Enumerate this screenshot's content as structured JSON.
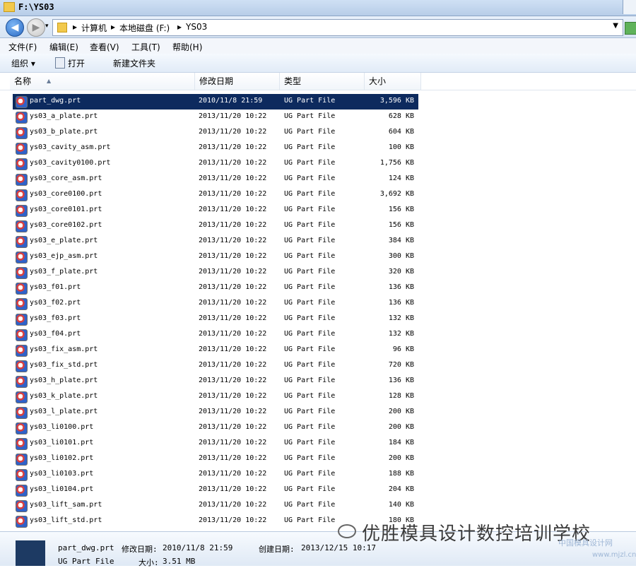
{
  "window": {
    "title": "F:\\YS03"
  },
  "address": {
    "crumbs": [
      "计算机",
      "本地磁盘 (F:)",
      "YS03"
    ]
  },
  "menu": [
    "文件(F)",
    "编辑(E)",
    "查看(V)",
    "工具(T)",
    "帮助(H)"
  ],
  "toolbar": {
    "organize": "组织",
    "open": "打开",
    "new_folder": "新建文件夹"
  },
  "columns": {
    "name": "名称",
    "date": "修改日期",
    "type": "类型",
    "size": "大小"
  },
  "files": [
    {
      "name": "part_dwg.prt",
      "date": "2010/11/8 21:59",
      "type": "UG Part File",
      "size": "3,596 KB",
      "selected": true
    },
    {
      "name": "ys03_a_plate.prt",
      "date": "2013/11/20 10:22",
      "type": "UG Part File",
      "size": "628 KB"
    },
    {
      "name": "ys03_b_plate.prt",
      "date": "2013/11/20 10:22",
      "type": "UG Part File",
      "size": "604 KB"
    },
    {
      "name": "ys03_cavity_asm.prt",
      "date": "2013/11/20 10:22",
      "type": "UG Part File",
      "size": "100 KB"
    },
    {
      "name": "ys03_cavity0100.prt",
      "date": "2013/11/20 10:22",
      "type": "UG Part File",
      "size": "1,756 KB"
    },
    {
      "name": "ys03_core_asm.prt",
      "date": "2013/11/20 10:22",
      "type": "UG Part File",
      "size": "124 KB"
    },
    {
      "name": "ys03_core0100.prt",
      "date": "2013/11/20 10:22",
      "type": "UG Part File",
      "size": "3,692 KB"
    },
    {
      "name": "ys03_core0101.prt",
      "date": "2013/11/20 10:22",
      "type": "UG Part File",
      "size": "156 KB"
    },
    {
      "name": "ys03_core0102.prt",
      "date": "2013/11/20 10:22",
      "type": "UG Part File",
      "size": "156 KB"
    },
    {
      "name": "ys03_e_plate.prt",
      "date": "2013/11/20 10:22",
      "type": "UG Part File",
      "size": "384 KB"
    },
    {
      "name": "ys03_ejp_asm.prt",
      "date": "2013/11/20 10:22",
      "type": "UG Part File",
      "size": "300 KB"
    },
    {
      "name": "ys03_f_plate.prt",
      "date": "2013/11/20 10:22",
      "type": "UG Part File",
      "size": "320 KB"
    },
    {
      "name": "ys03_f01.prt",
      "date": "2013/11/20 10:22",
      "type": "UG Part File",
      "size": "136 KB"
    },
    {
      "name": "ys03_f02.prt",
      "date": "2013/11/20 10:22",
      "type": "UG Part File",
      "size": "136 KB"
    },
    {
      "name": "ys03_f03.prt",
      "date": "2013/11/20 10:22",
      "type": "UG Part File",
      "size": "132 KB"
    },
    {
      "name": "ys03_f04.prt",
      "date": "2013/11/20 10:22",
      "type": "UG Part File",
      "size": "132 KB"
    },
    {
      "name": "ys03_fix_asm.prt",
      "date": "2013/11/20 10:22",
      "type": "UG Part File",
      "size": "96 KB"
    },
    {
      "name": "ys03_fix_std.prt",
      "date": "2013/11/20 10:22",
      "type": "UG Part File",
      "size": "720 KB"
    },
    {
      "name": "ys03_h_plate.prt",
      "date": "2013/11/20 10:22",
      "type": "UG Part File",
      "size": "136 KB"
    },
    {
      "name": "ys03_k_plate.prt",
      "date": "2013/11/20 10:22",
      "type": "UG Part File",
      "size": "128 KB"
    },
    {
      "name": "ys03_l_plate.prt",
      "date": "2013/11/20 10:22",
      "type": "UG Part File",
      "size": "200 KB"
    },
    {
      "name": "ys03_li0100.prt",
      "date": "2013/11/20 10:22",
      "type": "UG Part File",
      "size": "200 KB"
    },
    {
      "name": "ys03_li0101.prt",
      "date": "2013/11/20 10:22",
      "type": "UG Part File",
      "size": "184 KB"
    },
    {
      "name": "ys03_li0102.prt",
      "date": "2013/11/20 10:22",
      "type": "UG Part File",
      "size": "200 KB"
    },
    {
      "name": "ys03_li0103.prt",
      "date": "2013/11/20 10:22",
      "type": "UG Part File",
      "size": "188 KB"
    },
    {
      "name": "ys03_li0104.prt",
      "date": "2013/11/20 10:22",
      "type": "UG Part File",
      "size": "204 KB"
    },
    {
      "name": "ys03_lift_sam.prt",
      "date": "2013/11/20 10:22",
      "type": "UG Part File",
      "size": "140 KB"
    },
    {
      "name": "ys03_lift_std.prt",
      "date": "2013/11/20 10:22",
      "type": "UG Part File",
      "size": "180 KB"
    }
  ],
  "details": {
    "filename": "part_dwg.prt",
    "modified_label": "修改日期:",
    "modified": "2010/11/8 21:59",
    "created_label": "创建日期:",
    "created": "2013/12/15 10:17",
    "type": "UG Part File",
    "size_label": "大小:",
    "size": "3.51 MB"
  },
  "watermark": {
    "text": "优胜模具设计数控培训学校",
    "site": "中国模具设计网",
    "url": "www.mjzl.cn"
  },
  "colors": {
    "selection": "#0d2a5e",
    "title_bar": "#cfe0f4"
  }
}
